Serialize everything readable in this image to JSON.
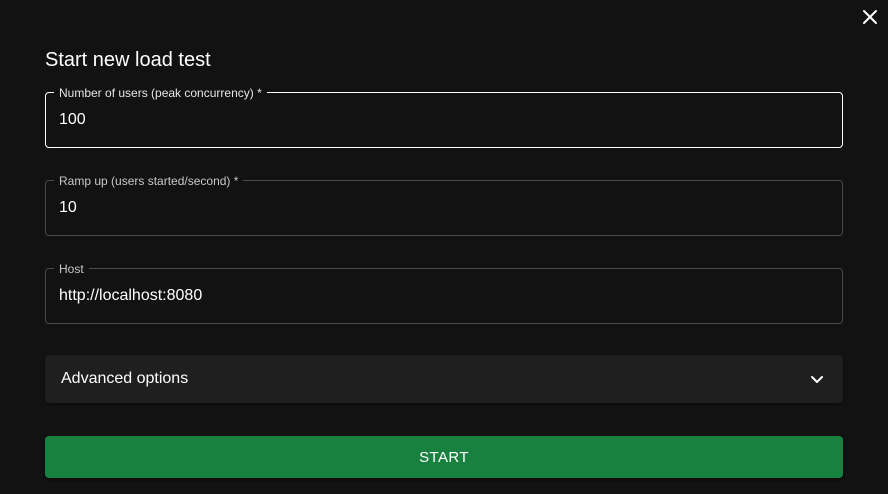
{
  "dialog": {
    "title": "Start new load test",
    "close_icon": "close-icon"
  },
  "fields": {
    "users": {
      "label": "Number of users (peak concurrency)",
      "required_mark": " *",
      "value": "100",
      "focused": true
    },
    "ramp_up": {
      "label": "Ramp up (users started/second)",
      "required_mark": " *",
      "value": "10"
    },
    "host": {
      "label": "Host",
      "value": "http://localhost:8080"
    }
  },
  "advanced": {
    "label": "Advanced options",
    "expand_icon": "chevron-down-icon"
  },
  "start_button": {
    "label": "START"
  },
  "colors": {
    "background": "#121212",
    "accordion": "#1f1f1f",
    "primary_button": "#188140",
    "border": "#4a4a4a",
    "focused_border": "#ffffff"
  }
}
